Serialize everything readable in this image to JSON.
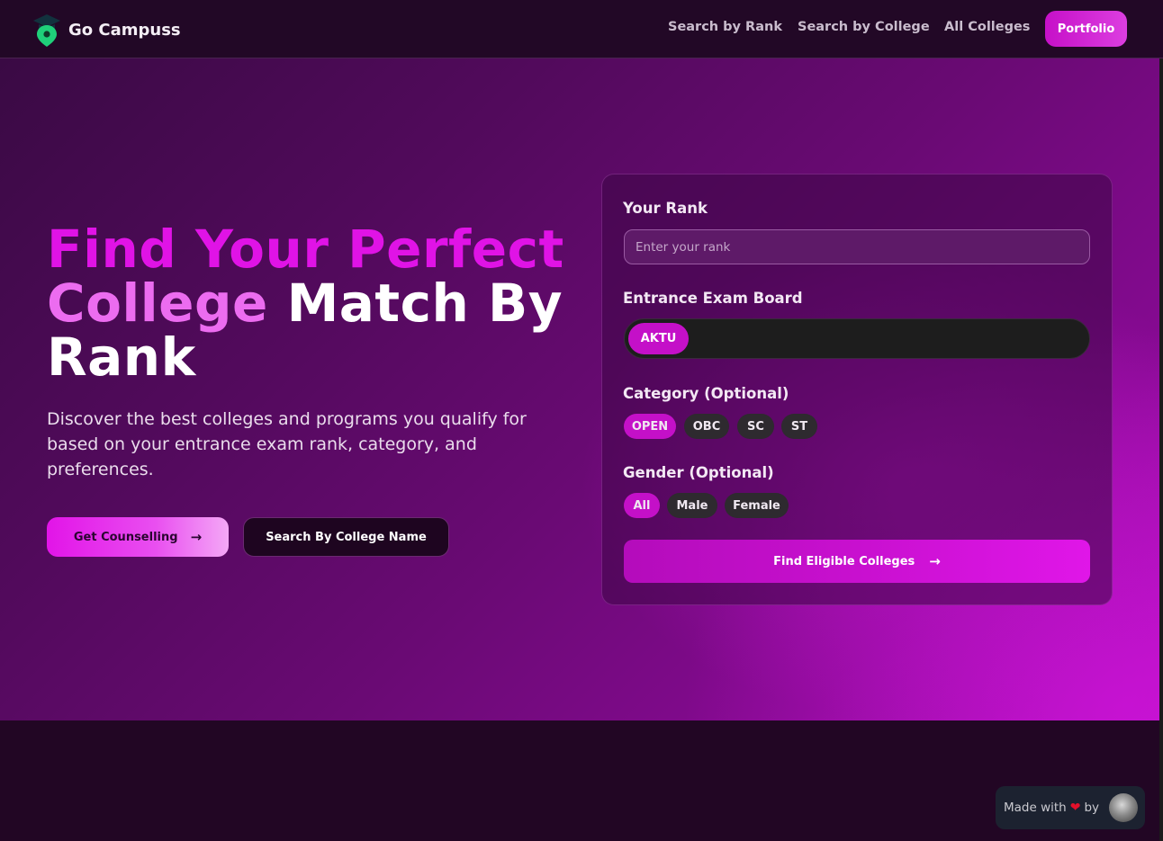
{
  "nav": {
    "brand": "Go Campuss",
    "links": [
      "Search by Rank",
      "Search by College",
      "All Colleges"
    ],
    "portfolio": "Portfolio"
  },
  "hero": {
    "title_part1": "Find Your Perfect",
    "title_part2": "College",
    "title_part3": "Match By",
    "title_part4": "Rank",
    "subtitle": "Discover the best colleges and programs you qualify for based on your entrance exam rank, category, and preferences.",
    "primary_button": "Get Counselling",
    "secondary_button": "Search By College Name"
  },
  "form": {
    "rank_label": "Your Rank",
    "rank_placeholder": "Enter your rank",
    "board_label": "Entrance Exam Board",
    "board_selected": "AKTU",
    "category_label": "Category (Optional)",
    "categories": [
      "OPEN",
      "OBC",
      "SC",
      "ST"
    ],
    "gender_label": "Gender (Optional)",
    "genders": [
      "All",
      "Male",
      "Female"
    ],
    "submit": "Find Eligible Colleges"
  },
  "footer": {
    "made_with": "Made with",
    "by": "by"
  },
  "colors": {
    "accent": "#c410c8",
    "nav_bg": "#220826",
    "footer_bg": "#220624"
  },
  "icons": [
    "graduation-cap-logo-icon",
    "arrow-right-icon",
    "heart-icon",
    "avatar"
  ]
}
